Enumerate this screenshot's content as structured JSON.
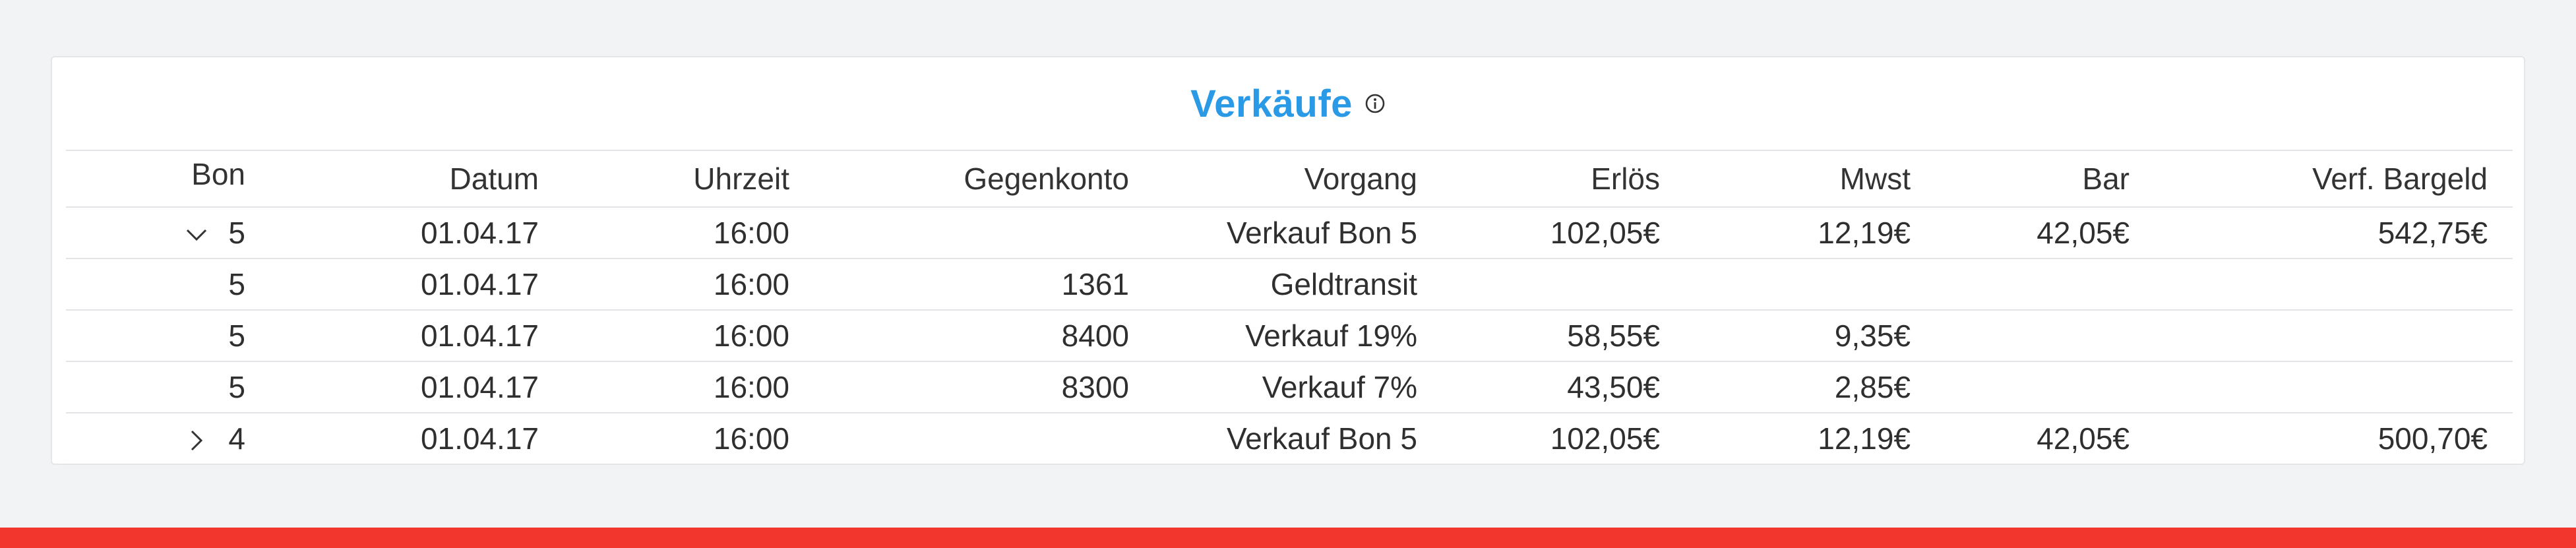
{
  "card": {
    "title": "Verkäufe",
    "info_icon": "info-icon"
  },
  "table": {
    "headers": {
      "bon": "Bon",
      "datum": "Datum",
      "uhrzeit": "Uhrzeit",
      "gegenkonto": "Gegenkonto",
      "vorgang": "Vorgang",
      "erloes": "Erlös",
      "mwst": "Mwst",
      "bar": "Bar",
      "verf_bargeld": "Verf. Bargeld"
    },
    "rows": [
      {
        "expander": "chevron-down-icon",
        "bon": "5",
        "datum": "01.04.17",
        "uhrzeit": "16:00",
        "gegenkonto": "",
        "vorgang": "Verkauf Bon 5",
        "erloes": "102,05€",
        "mwst": "12,19€",
        "bar": "42,05€",
        "verf_bargeld": "542,75€"
      },
      {
        "expander": "",
        "bon": "5",
        "datum": "01.04.17",
        "uhrzeit": "16:00",
        "gegenkonto": "1361",
        "vorgang": "Geldtransit",
        "erloes": "",
        "mwst": "",
        "bar": "",
        "verf_bargeld": ""
      },
      {
        "expander": "",
        "bon": "5",
        "datum": "01.04.17",
        "uhrzeit": "16:00",
        "gegenkonto": "8400",
        "vorgang": "Verkauf 19%",
        "erloes": "58,55€",
        "mwst": "9,35€",
        "bar": "",
        "verf_bargeld": ""
      },
      {
        "expander": "",
        "bon": "5",
        "datum": "01.04.17",
        "uhrzeit": "16:00",
        "gegenkonto": "8300",
        "vorgang": "Verkauf 7%",
        "erloes": "43,50€",
        "mwst": "2,85€",
        "bar": "",
        "verf_bargeld": ""
      },
      {
        "expander": "chevron-right-icon",
        "bon": "4",
        "datum": "01.04.17",
        "uhrzeit": "16:00",
        "gegenkonto": "",
        "vorgang": "Verkauf Bon 5",
        "erloes": "102,05€",
        "mwst": "12,19€",
        "bar": "42,05€",
        "verf_bargeld": "500,70€"
      }
    ]
  },
  "colors": {
    "accent": "#2a9ae6",
    "bottom_bar": "#f2362d"
  }
}
